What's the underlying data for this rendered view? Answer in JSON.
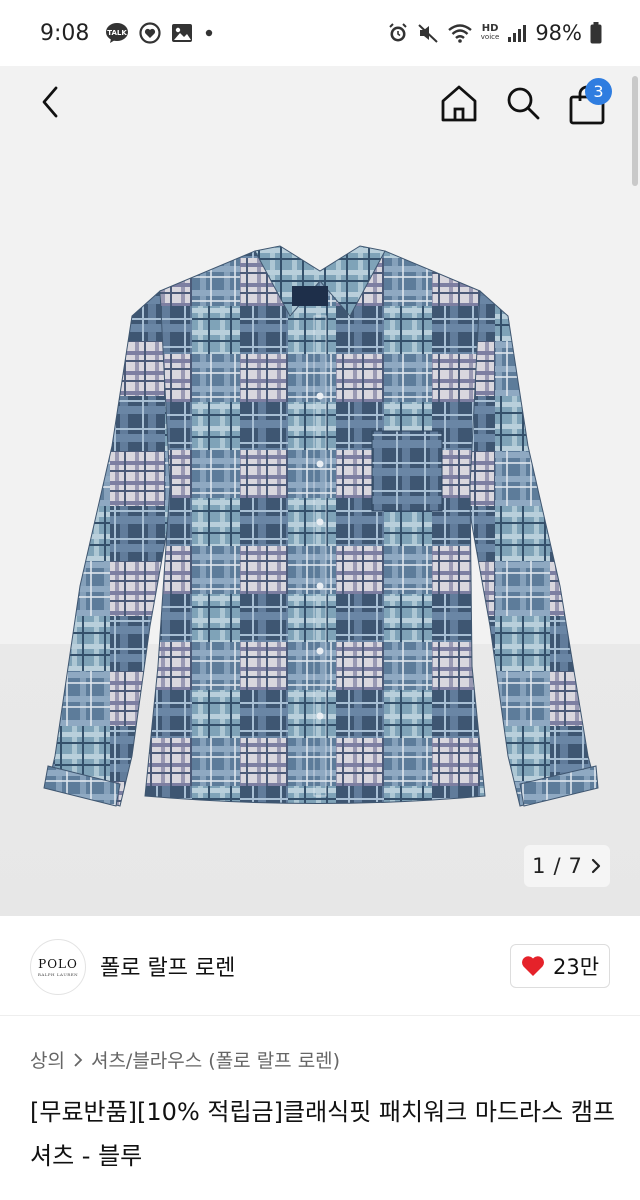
{
  "status_bar": {
    "time": "9:08",
    "battery": "98%",
    "network_label_top": "HD",
    "network_label_bottom": "voice"
  },
  "nav": {
    "cart_count": "3"
  },
  "gallery": {
    "current": "1",
    "separator": "/",
    "total": "7"
  },
  "brand": {
    "name": "폴로 랄프 로렌",
    "logo_text": "POLO",
    "logo_subtext": "RALPH LAUREN",
    "likes": "23만"
  },
  "breadcrumb": {
    "category": "상의",
    "subcategory": "셔츠/블라우스 (폴로 랄프 로렌)"
  },
  "product": {
    "title": "[무료반품][10% 적립금]클래식핏 패치워크 마드라스 캠프 셔츠 - 블루"
  },
  "colors": {
    "accent": "#2f7de0",
    "heart": "#e5222a",
    "shirt_blue": "#5f7f9c"
  },
  "icons": [
    "talk-icon",
    "heart-circle-icon",
    "image-icon",
    "alarm-icon",
    "mute-icon",
    "wifi-icon",
    "signal-icon",
    "battery-icon",
    "back-icon",
    "home-icon",
    "search-icon",
    "bag-icon",
    "chevron-right-icon",
    "heart-icon"
  ]
}
